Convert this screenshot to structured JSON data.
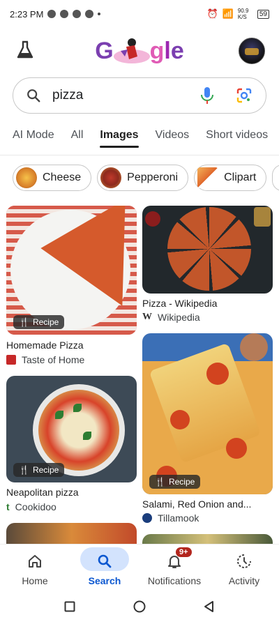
{
  "status": {
    "time": "2:23 PM",
    "battery": "59",
    "net": "90.9 K/S"
  },
  "search": {
    "query": "pizza"
  },
  "tabs": [
    "AI Mode",
    "All",
    "Images",
    "Videos",
    "Short videos"
  ],
  "chips": [
    "Cheese",
    "Pepperoni",
    "Clipart"
  ],
  "results": [
    {
      "title": "Homemade Pizza",
      "source": "Taste of Home",
      "tag": "Recipe"
    },
    {
      "title": "Pizza - Wikipedia",
      "source": "Wikipedia"
    },
    {
      "title": "Neapolitan pizza",
      "source": "Cookidoo",
      "tag": "Recipe"
    },
    {
      "title": "Salami, Red Onion and...",
      "source": "Tillamook",
      "tag": "Recipe"
    }
  ],
  "bottom_nav": [
    {
      "label": "Home"
    },
    {
      "label": "Search"
    },
    {
      "label": "Notifications",
      "badge": "9+"
    },
    {
      "label": "Activity"
    }
  ],
  "colors": {
    "accent": "#0b57d0",
    "selected_bg": "#d3e3fd",
    "badge": "#b3261e"
  }
}
